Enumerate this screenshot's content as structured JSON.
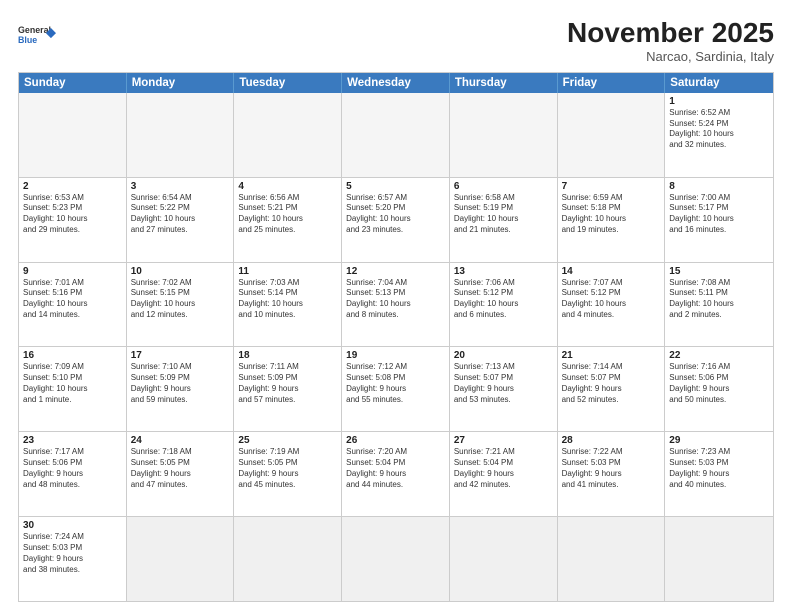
{
  "header": {
    "logo_general": "General",
    "logo_blue": "Blue",
    "month_title": "November 2025",
    "subtitle": "Narcao, Sardinia, Italy"
  },
  "day_headers": [
    "Sunday",
    "Monday",
    "Tuesday",
    "Wednesday",
    "Thursday",
    "Friday",
    "Saturday"
  ],
  "rows": [
    [
      {
        "date": "",
        "text": ""
      },
      {
        "date": "",
        "text": ""
      },
      {
        "date": "",
        "text": ""
      },
      {
        "date": "",
        "text": ""
      },
      {
        "date": "",
        "text": ""
      },
      {
        "date": "",
        "text": ""
      },
      {
        "date": "1",
        "text": "Sunrise: 6:52 AM\nSunset: 5:24 PM\nDaylight: 10 hours\nand 32 minutes."
      }
    ],
    [
      {
        "date": "2",
        "text": "Sunrise: 6:53 AM\nSunset: 5:23 PM\nDaylight: 10 hours\nand 29 minutes."
      },
      {
        "date": "3",
        "text": "Sunrise: 6:54 AM\nSunset: 5:22 PM\nDaylight: 10 hours\nand 27 minutes."
      },
      {
        "date": "4",
        "text": "Sunrise: 6:56 AM\nSunset: 5:21 PM\nDaylight: 10 hours\nand 25 minutes."
      },
      {
        "date": "5",
        "text": "Sunrise: 6:57 AM\nSunset: 5:20 PM\nDaylight: 10 hours\nand 23 minutes."
      },
      {
        "date": "6",
        "text": "Sunrise: 6:58 AM\nSunset: 5:19 PM\nDaylight: 10 hours\nand 21 minutes."
      },
      {
        "date": "7",
        "text": "Sunrise: 6:59 AM\nSunset: 5:18 PM\nDaylight: 10 hours\nand 19 minutes."
      },
      {
        "date": "8",
        "text": "Sunrise: 7:00 AM\nSunset: 5:17 PM\nDaylight: 10 hours\nand 16 minutes."
      }
    ],
    [
      {
        "date": "9",
        "text": "Sunrise: 7:01 AM\nSunset: 5:16 PM\nDaylight: 10 hours\nand 14 minutes."
      },
      {
        "date": "10",
        "text": "Sunrise: 7:02 AM\nSunset: 5:15 PM\nDaylight: 10 hours\nand 12 minutes."
      },
      {
        "date": "11",
        "text": "Sunrise: 7:03 AM\nSunset: 5:14 PM\nDaylight: 10 hours\nand 10 minutes."
      },
      {
        "date": "12",
        "text": "Sunrise: 7:04 AM\nSunset: 5:13 PM\nDaylight: 10 hours\nand 8 minutes."
      },
      {
        "date": "13",
        "text": "Sunrise: 7:06 AM\nSunset: 5:12 PM\nDaylight: 10 hours\nand 6 minutes."
      },
      {
        "date": "14",
        "text": "Sunrise: 7:07 AM\nSunset: 5:12 PM\nDaylight: 10 hours\nand 4 minutes."
      },
      {
        "date": "15",
        "text": "Sunrise: 7:08 AM\nSunset: 5:11 PM\nDaylight: 10 hours\nand 2 minutes."
      }
    ],
    [
      {
        "date": "16",
        "text": "Sunrise: 7:09 AM\nSunset: 5:10 PM\nDaylight: 10 hours\nand 1 minute."
      },
      {
        "date": "17",
        "text": "Sunrise: 7:10 AM\nSunset: 5:09 PM\nDaylight: 9 hours\nand 59 minutes."
      },
      {
        "date": "18",
        "text": "Sunrise: 7:11 AM\nSunset: 5:09 PM\nDaylight: 9 hours\nand 57 minutes."
      },
      {
        "date": "19",
        "text": "Sunrise: 7:12 AM\nSunset: 5:08 PM\nDaylight: 9 hours\nand 55 minutes."
      },
      {
        "date": "20",
        "text": "Sunrise: 7:13 AM\nSunset: 5:07 PM\nDaylight: 9 hours\nand 53 minutes."
      },
      {
        "date": "21",
        "text": "Sunrise: 7:14 AM\nSunset: 5:07 PM\nDaylight: 9 hours\nand 52 minutes."
      },
      {
        "date": "22",
        "text": "Sunrise: 7:16 AM\nSunset: 5:06 PM\nDaylight: 9 hours\nand 50 minutes."
      }
    ],
    [
      {
        "date": "23",
        "text": "Sunrise: 7:17 AM\nSunset: 5:06 PM\nDaylight: 9 hours\nand 48 minutes."
      },
      {
        "date": "24",
        "text": "Sunrise: 7:18 AM\nSunset: 5:05 PM\nDaylight: 9 hours\nand 47 minutes."
      },
      {
        "date": "25",
        "text": "Sunrise: 7:19 AM\nSunset: 5:05 PM\nDaylight: 9 hours\nand 45 minutes."
      },
      {
        "date": "26",
        "text": "Sunrise: 7:20 AM\nSunset: 5:04 PM\nDaylight: 9 hours\nand 44 minutes."
      },
      {
        "date": "27",
        "text": "Sunrise: 7:21 AM\nSunset: 5:04 PM\nDaylight: 9 hours\nand 42 minutes."
      },
      {
        "date": "28",
        "text": "Sunrise: 7:22 AM\nSunset: 5:03 PM\nDaylight: 9 hours\nand 41 minutes."
      },
      {
        "date": "29",
        "text": "Sunrise: 7:23 AM\nSunset: 5:03 PM\nDaylight: 9 hours\nand 40 minutes."
      }
    ],
    [
      {
        "date": "30",
        "text": "Sunrise: 7:24 AM\nSunset: 5:03 PM\nDaylight: 9 hours\nand 38 minutes."
      },
      {
        "date": "",
        "text": ""
      },
      {
        "date": "",
        "text": ""
      },
      {
        "date": "",
        "text": ""
      },
      {
        "date": "",
        "text": ""
      },
      {
        "date": "",
        "text": ""
      },
      {
        "date": "",
        "text": ""
      }
    ]
  ]
}
